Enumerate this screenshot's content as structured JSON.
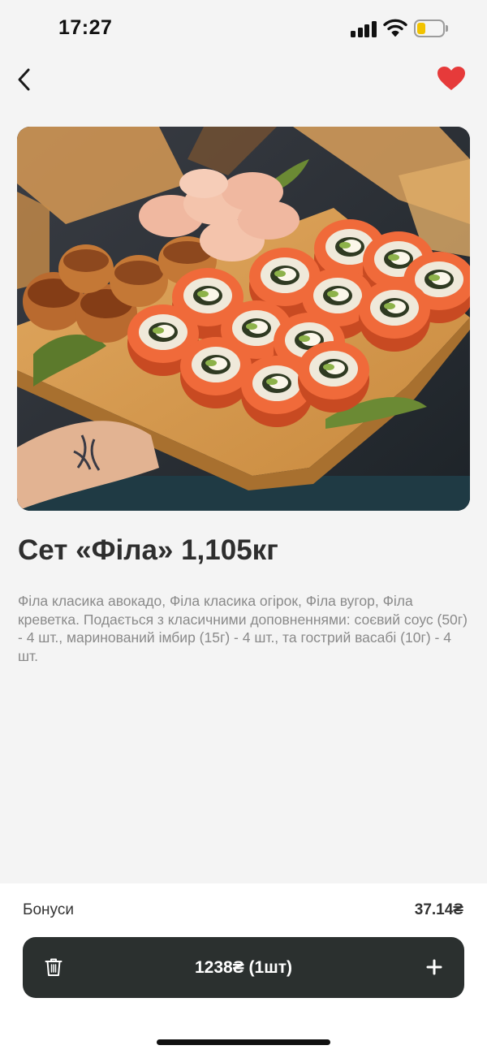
{
  "status_bar": {
    "time": "17:27",
    "signal_icon": "cellular-signal-icon",
    "wifi_icon": "wifi-icon",
    "battery_icon": "battery-low-icon",
    "battery_level": 0.25,
    "battery_color": "#f2c300"
  },
  "nav": {
    "back_icon": "chevron-left-icon",
    "favorite_icon": "heart-icon",
    "favorite_color": "#e63a3a",
    "favorite_active": true
  },
  "product": {
    "image_icon": "sushi-set-photo",
    "title": "Сет «Філа» 1,105кг",
    "description": "Філа класика авокадо, Філа класика огірок, Філа вугор, Філа креветка. Подається з класичними доповненнями: соєвий соус (50г) - 4 шт., маринований імбир (15г) - 4 шт., та гострий васабі (10г) - 4 шт."
  },
  "bonus": {
    "label": "Бонуси",
    "value": "37.14₴"
  },
  "cart": {
    "price_label": "1238₴  (1шт)",
    "trash_icon": "trash-icon",
    "plus_icon": "plus-icon",
    "background_color": "#2b302f"
  }
}
